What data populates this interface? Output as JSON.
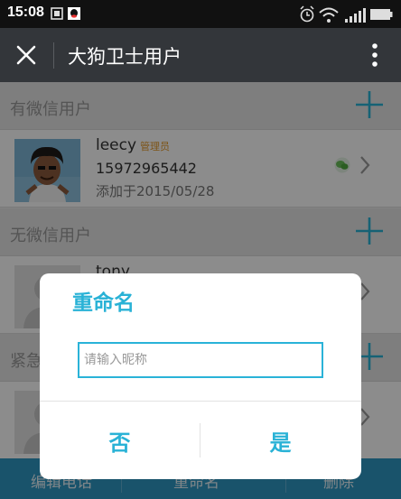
{
  "status_bar": {
    "time": "15:08",
    "icons": [
      "sim-icon",
      "qq-icon",
      "alarm-icon",
      "wifi-icon",
      "signal-icon",
      "battery-icon"
    ]
  },
  "title_bar": {
    "title": "大狗卫士用户",
    "close_icon": "close-icon",
    "more_icon": "more-vertical-icon"
  },
  "sections": {
    "wechat_users": {
      "label": "有微信用户",
      "users": [
        {
          "name": "leecy",
          "badge": "管理员",
          "phone": "15972965442",
          "added": "添加于2015/05/28"
        }
      ]
    },
    "non_wechat_users": {
      "label": "无微信用户",
      "users": [
        {
          "name": "tony"
        }
      ]
    },
    "emergency": {
      "label": "紧急"
    }
  },
  "toolbar": {
    "edit_phone": "编辑电话",
    "rename": "重命名",
    "delete": "删除"
  },
  "dialog": {
    "title": "重命名",
    "input_value": "",
    "input_placeholder": "请输入昵称",
    "no_label": "否",
    "yes_label": "是"
  },
  "colors": {
    "accent": "#29b2d6",
    "title_bar": "#33363a",
    "toolbar": "#2f97c4",
    "badge": "#e49a2a"
  }
}
